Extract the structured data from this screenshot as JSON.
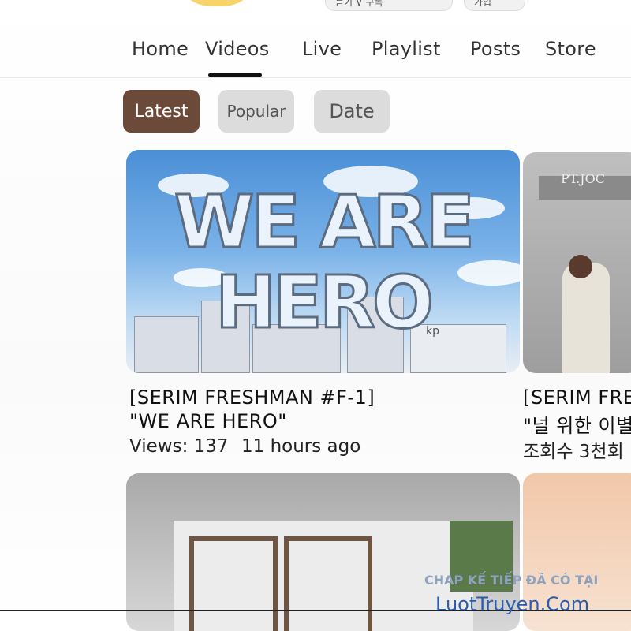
{
  "header": {
    "pill_a": "듣기 ∨ 구독",
    "pill_b": "가입"
  },
  "tabs": [
    {
      "label": "Home"
    },
    {
      "label": "Videos"
    },
    {
      "label": "Live"
    },
    {
      "label": "Playlist"
    },
    {
      "label": "Posts"
    },
    {
      "label": "Store"
    }
  ],
  "active_tab": "Videos",
  "filters": [
    {
      "label": "Latest",
      "active": true
    },
    {
      "label": "Popular",
      "active": false
    },
    {
      "label": "Date",
      "active": false
    }
  ],
  "videos": [
    {
      "thumbnail_text_1": "WE ARE",
      "thumbnail_text_2": "HERO",
      "sign_text": "kp",
      "title_1": "[SERIM FRESHMAN #F-1]",
      "title_2": "\"WE ARE HERO\"",
      "views": "Views: 137",
      "age": "11 hours ago"
    },
    {
      "sign_text": "PT.JOC",
      "title_1": "[SERIM FRES",
      "title_2": "\"널 위한 이별\"",
      "views": "조회수 3천회"
    }
  ],
  "watermark": {
    "line1": "CHAP KẾ TIẾP ĐÃ CÓ TẠI",
    "line2": "LuotTruyen.Com"
  },
  "colors": {
    "active_chip": "#6b4a3a",
    "idle_chip": "#dcdcdc",
    "underline": "#111111",
    "watermark": "#2a5db0"
  }
}
